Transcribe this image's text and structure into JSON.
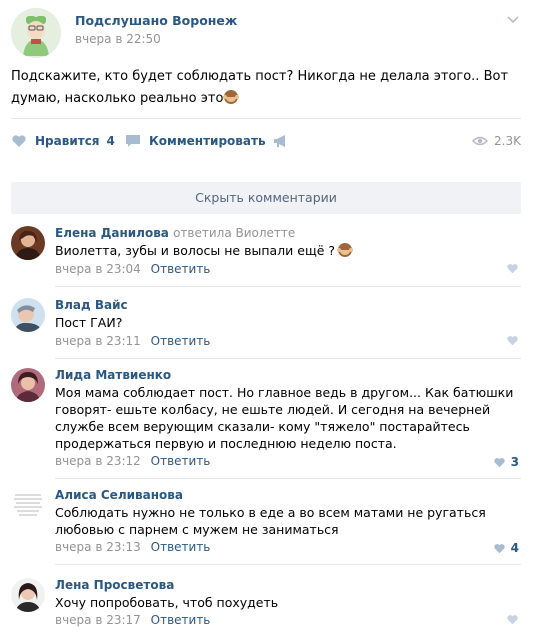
{
  "post": {
    "group_name": "Подслушано Воронеж",
    "time": "вчера в 22:50",
    "text": "Подскажите, кто будет соблюдать пост? Никогда не делала этого.. Вот думаю, насколько реально это",
    "likes_label": "Нравится",
    "likes_count": "4",
    "comment_label": "Комментировать",
    "views": "2.3K"
  },
  "collapse_label": "Скрыть комментарии",
  "reply_label": "Ответить",
  "comments": [
    {
      "author": "Елена Данилова",
      "reply_to": "ответила Виолетте",
      "text": "Виолетта, зубы и волосы не выпали ещё ?",
      "time": "вчера в 23:04",
      "likes": ""
    },
    {
      "author": "Влад Вайс",
      "reply_to": "",
      "text": "Пост ГАИ?",
      "time": "вчера в 23:11",
      "likes": ""
    },
    {
      "author": "Лида Матвиенко",
      "reply_to": "",
      "text": "Моя мама соблюдает пост. Но главное ведь в другом... Как батюшки говорят- ешьте колбасу, не ешьте людей. И сегодня на вечерней службе всем верующим сказали- кому \"тяжело\" постарайтесь продержаться первую и последнюю неделю поста.",
      "time": "вчера в 23:12",
      "likes": "3"
    },
    {
      "author": "Алиса Селиванова",
      "reply_to": "",
      "text": "Соблюдать нужно не только в еде а во всем матами не ругаться любовью с парнем с мужем не заниматься",
      "time": "вчера в 23:13",
      "likes": "4"
    },
    {
      "author": "Лена Просветова",
      "reply_to": "",
      "text": "Хочу попробовать, чтоб похудеть",
      "time": "вчера в 23:17",
      "likes": ""
    }
  ]
}
